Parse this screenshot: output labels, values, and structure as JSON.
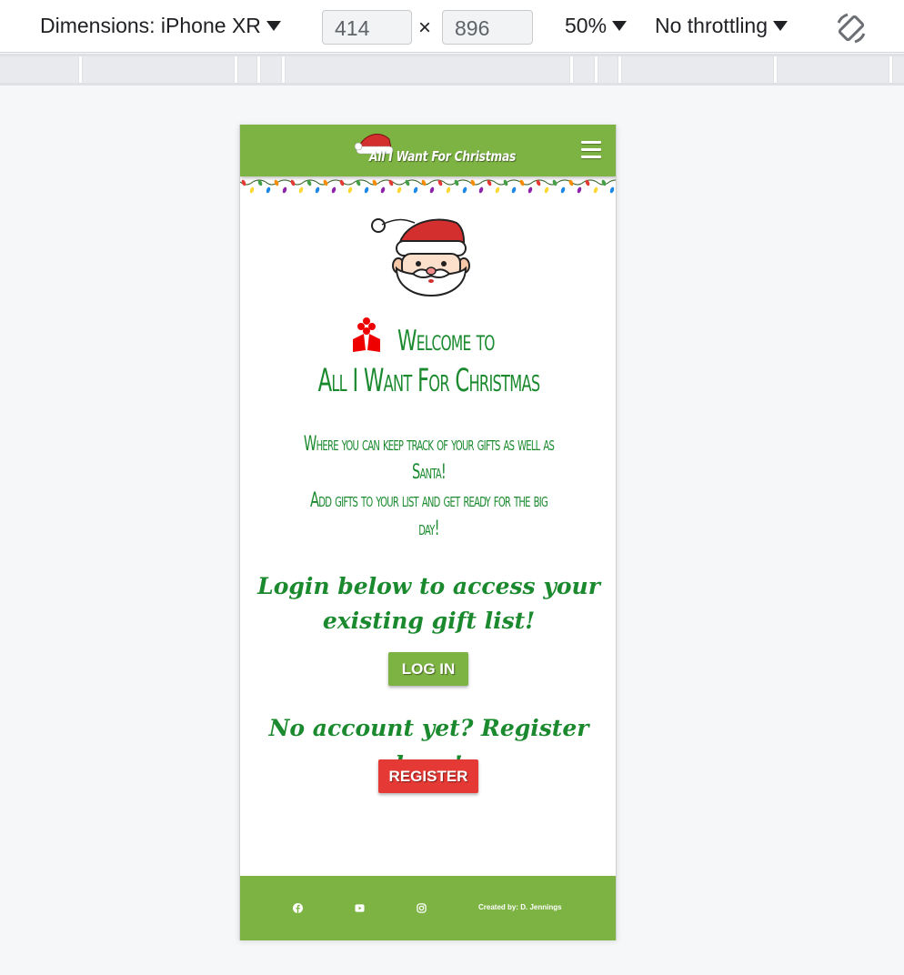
{
  "devtools": {
    "device_label": "Dimensions: iPhone XR",
    "width_value": "414",
    "height_value": "896",
    "times_symbol": "×",
    "zoom_label": "50%",
    "throttle_label": "No throttling",
    "rotate_icon": "rotate-icon"
  },
  "site": {
    "brand": "All I Want For Christmas",
    "menu_icon": "hamburger-icon",
    "hero_image": "santa-face",
    "welcome_line1": "Welcome to",
    "welcome_line2": "All I Want For Christmas",
    "tagline_1": "Where you can keep track of your gifts as well as Santa!",
    "tagline_2": "Add gifts to your list and get ready for the big day!",
    "login_prompt": "Login below to access your existing gift list!",
    "login_button": "LOG IN",
    "register_prompt": "No account yet? Register here!",
    "register_button": "REGISTER",
    "footer": {
      "icons": [
        "facebook-icon",
        "youtube-icon",
        "instagram-icon"
      ],
      "credit": "Created by: D. Jennings"
    }
  },
  "colors": {
    "brand_green": "#7cb342",
    "text_green": "#1b8a2f",
    "register_red": "#e53935"
  }
}
